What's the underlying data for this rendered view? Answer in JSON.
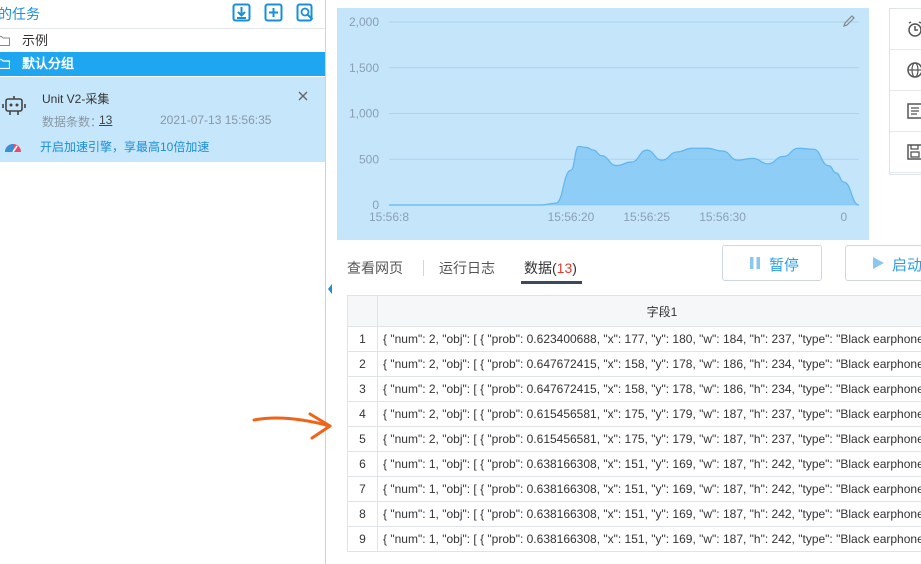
{
  "sidebar": {
    "title": "的任务",
    "folders": [
      {
        "label": "示例"
      },
      {
        "label": "默认分组"
      }
    ],
    "task": {
      "name": "Unit V2-采集",
      "count_label": "数据条数：",
      "count": "13",
      "time": "2021-07-13 15:56:35",
      "speed_text": "开启加速引擎，享最高10倍加速"
    }
  },
  "chart_data": {
    "type": "area",
    "title": "",
    "xlabel": "",
    "ylabel": "",
    "ylim": [
      0,
      2000
    ],
    "y_ticks": [
      "0",
      "500",
      "1,000",
      "1,500",
      "2,000"
    ],
    "x_tick_labels": [
      "15:56:8",
      "15:56:20",
      "15:56:25",
      "15:56:30",
      "0"
    ],
    "grid": true,
    "color": "#7cc4f3",
    "points_x_seconds": [
      8,
      9,
      10,
      11,
      12,
      13,
      14,
      15,
      16,
      17,
      18,
      19,
      20,
      20.5,
      21,
      21.5,
      22,
      23,
      24,
      25,
      26,
      27,
      28,
      29,
      30,
      31,
      32,
      33,
      34,
      35,
      36,
      37,
      37.5,
      38,
      39
    ],
    "values": [
      0,
      0,
      0,
      0,
      0,
      0,
      0,
      0,
      0,
      0,
      0,
      20,
      380,
      640,
      630,
      600,
      540,
      430,
      470,
      600,
      490,
      580,
      620,
      620,
      590,
      490,
      510,
      450,
      530,
      620,
      610,
      430,
      350,
      250,
      0
    ]
  },
  "tabs": {
    "view": "查看网页",
    "log": "运行日志",
    "data": "数据(",
    "data_count": "13",
    "data_close": ")"
  },
  "controls": {
    "pause": "暂停",
    "start": "启动"
  },
  "table": {
    "header": "字段1",
    "rows": [
      {
        "idx": "1",
        "value": "{ \"num\": 2, \"obj\": [ { \"prob\": 0.623400688, \"x\": 177, \"y\": 180, \"w\": 184, \"h\": 237, \"type\": \"Black earphone"
      },
      {
        "idx": "2",
        "value": "{ \"num\": 2, \"obj\": [ { \"prob\": 0.647672415, \"x\": 158, \"y\": 178, \"w\": 186, \"h\": 234, \"type\": \"Black earphone"
      },
      {
        "idx": "3",
        "value": "{ \"num\": 2, \"obj\": [ { \"prob\": 0.647672415, \"x\": 158, \"y\": 178, \"w\": 186, \"h\": 234, \"type\": \"Black earphone"
      },
      {
        "idx": "4",
        "value": "{ \"num\": 2, \"obj\": [ { \"prob\": 0.615456581, \"x\": 175, \"y\": 179, \"w\": 187, \"h\": 237, \"type\": \"Black earphone"
      },
      {
        "idx": "5",
        "value": "{ \"num\": 2, \"obj\": [ { \"prob\": 0.615456581, \"x\": 175, \"y\": 179, \"w\": 187, \"h\": 237, \"type\": \"Black earphone"
      },
      {
        "idx": "6",
        "value": "{ \"num\": 1, \"obj\": [ { \"prob\": 0.638166308, \"x\": 151, \"y\": 169, \"w\": 187, \"h\": 242, \"type\": \"Black earphone"
      },
      {
        "idx": "7",
        "value": "{ \"num\": 1, \"obj\": [ { \"prob\": 0.638166308, \"x\": 151, \"y\": 169, \"w\": 187, \"h\": 242, \"type\": \"Black earphone"
      },
      {
        "idx": "8",
        "value": "{ \"num\": 1, \"obj\": [ { \"prob\": 0.638166308, \"x\": 151, \"y\": 169, \"w\": 187, \"h\": 242, \"type\": \"Black earphone"
      },
      {
        "idx": "9",
        "value": "{ \"num\": 1, \"obj\": [ { \"prob\": 0.638166308, \"x\": 151, \"y\": 169, \"w\": 187, \"h\": 242, \"type\": \"Black earphone"
      }
    ]
  },
  "colors": {
    "accent": "#1ea7f0",
    "selected_card": "#c6e6fb",
    "chart_bg": "#c4e5fa",
    "count_red": "#e03b2c",
    "annotation": "#f06418"
  },
  "icons": {
    "header": [
      "download-icon",
      "add-task-icon",
      "search-task-icon"
    ],
    "right_column": [
      "alarm-icon",
      "globe-icon",
      "list-icon",
      "save-icon"
    ]
  }
}
